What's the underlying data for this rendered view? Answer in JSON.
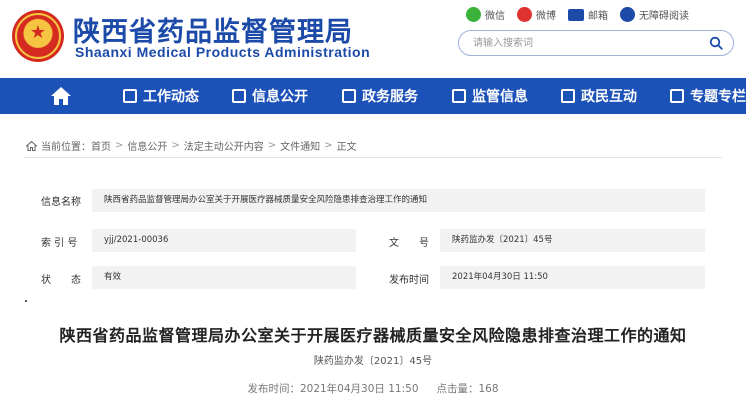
{
  "header": {
    "title_cn": "陕西省药品监督管理局",
    "title_en": "Shaanxi Medical Products Administration",
    "links": [
      {
        "label": "微信",
        "icon": "wechat-icon"
      },
      {
        "label": "微博",
        "icon": "weibo-icon"
      },
      {
        "label": "邮箱",
        "icon": "mail-icon"
      },
      {
        "label": "无障碍阅读",
        "icon": "accessibility-icon"
      }
    ],
    "search_placeholder": "请输入搜索词"
  },
  "nav": {
    "items": [
      {
        "label": "工作动态",
        "icon": "document-list-icon"
      },
      {
        "label": "信息公开",
        "icon": "folder-icon"
      },
      {
        "label": "政务服务",
        "icon": "service-icon"
      },
      {
        "label": "监管信息",
        "icon": "clipboard-icon"
      },
      {
        "label": "政民互动",
        "icon": "interaction-icon"
      },
      {
        "label": "专题专栏",
        "icon": "flag-icon"
      }
    ]
  },
  "breadcrumb": {
    "prefix": "当前位置：",
    "items": [
      "首页",
      "信息公开",
      "法定主动公开内容",
      "文件通知",
      "正文"
    ]
  },
  "info": {
    "name_label": "信息名称",
    "name_value": "陕西省药品监督管理局办公室关于开展医疗器械质量安全风险隐患排查治理工作的通知",
    "index_label": "索 引 号",
    "index_value": "yjj/2021-00036",
    "docno_label": "文　　号",
    "docno_value": "陕药监办发〔2021〕45号",
    "status_label": "状　　态",
    "status_value": "有效",
    "date_label": "发布时间",
    "date_value": "2021年04月30日 11:50"
  },
  "article": {
    "title": "陕西省药品监督管理局办公室关于开展医疗器械质量安全风险隐患排查治理工作的通知",
    "doc_no": "陕药监办发〔2021〕45号",
    "publish_label": "发布时间：2021年04月30日 11:50",
    "views_label": "点击量：168"
  },
  "colors": {
    "brand_blue": "#1b4aa8",
    "nav_blue": "#1c52b8",
    "emblem_red": "#d42a1f",
    "emblem_gold": "#f5c542"
  }
}
